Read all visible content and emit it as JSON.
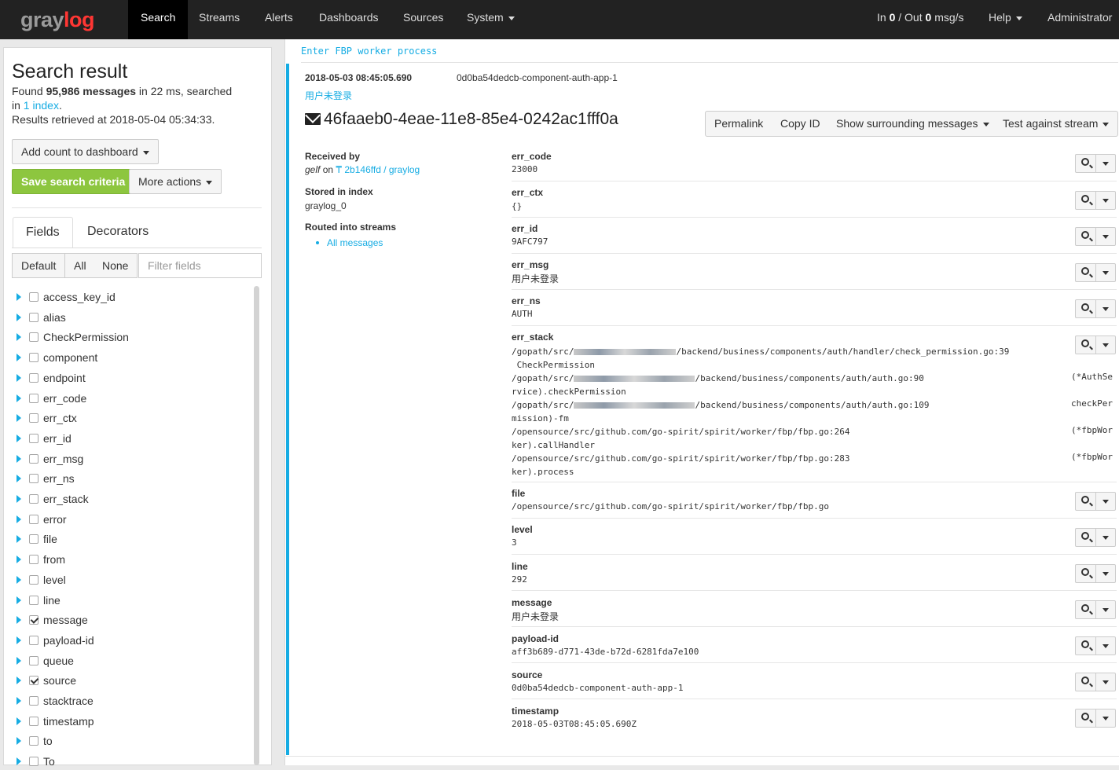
{
  "app": {
    "logo_left": "gray",
    "logo_right": "log",
    "nav": [
      "Search",
      "Streams",
      "Alerts",
      "Dashboards",
      "Sources",
      "System"
    ],
    "throughput_in_label": "In",
    "throughput_in": "0",
    "throughput_sep": "/ Out",
    "throughput_out": "0",
    "throughput_unit": "msg/s",
    "help": "Help",
    "user": "Administrator"
  },
  "sidebar": {
    "title": "Search result",
    "found_prefix": "Found",
    "found_count": "95,986 messages",
    "found_suffix": "in 22 ms, searched",
    "in_word": "in",
    "index_link": "1 index",
    "retrieved": "Results retrieved at 2018-05-04 05:34:33.",
    "add_count": "Add count to dashboard",
    "save_search": "Save search criteria",
    "more_actions": "More actions",
    "tabs": [
      "Fields",
      "Decorators"
    ],
    "filter_buttons": [
      "Default",
      "All",
      "None"
    ],
    "filter_placeholder": "Filter fields",
    "fields": [
      {
        "name": "access_key_id",
        "checked": false
      },
      {
        "name": "alias",
        "checked": false
      },
      {
        "name": "CheckPermission",
        "checked": false
      },
      {
        "name": "component",
        "checked": false
      },
      {
        "name": "endpoint",
        "checked": false
      },
      {
        "name": "err_code",
        "checked": false
      },
      {
        "name": "err_ctx",
        "checked": false
      },
      {
        "name": "err_id",
        "checked": false
      },
      {
        "name": "err_msg",
        "checked": false
      },
      {
        "name": "err_ns",
        "checked": false
      },
      {
        "name": "err_stack",
        "checked": false
      },
      {
        "name": "error",
        "checked": false
      },
      {
        "name": "file",
        "checked": false
      },
      {
        "name": "from",
        "checked": false
      },
      {
        "name": "level",
        "checked": false
      },
      {
        "name": "line",
        "checked": false
      },
      {
        "name": "message",
        "checked": true
      },
      {
        "name": "payload-id",
        "checked": false
      },
      {
        "name": "queue",
        "checked": false
      },
      {
        "name": "source",
        "checked": true
      },
      {
        "name": "stacktrace",
        "checked": false
      },
      {
        "name": "timestamp",
        "checked": false
      },
      {
        "name": "to",
        "checked": false
      },
      {
        "name": "To",
        "checked": false
      }
    ]
  },
  "message": {
    "header": "Enter FBP worker process",
    "timestamp": "2018-05-03 08:45:05.690",
    "source": "0d0ba54dedcb-component-auth-app-1",
    "summary": "用户未登录",
    "id": "46faaeb0-4eae-11e8-85e4-0242ac1fff0a",
    "toolbar": {
      "permalink": "Permalink",
      "copy_id": "Copy ID",
      "surrounding": "Show surrounding messages",
      "test_stream": "Test against stream"
    },
    "received_label": "Received by",
    "received_input": "gelf",
    "received_on": "on",
    "received_node": "2b146ffd / graylog",
    "stored_label": "Stored in index",
    "stored_value": "graylog_0",
    "routed_label": "Routed into streams",
    "routed_stream": "All messages",
    "fields": {
      "err_code": {
        "name": "err_code",
        "value": "23000"
      },
      "err_ctx": {
        "name": "err_ctx",
        "value": "{}"
      },
      "err_id": {
        "name": "err_id",
        "value": "9AFC797"
      },
      "err_msg": {
        "name": "err_msg",
        "value": "用户未登录"
      },
      "err_ns": {
        "name": "err_ns",
        "value": "AUTH"
      },
      "err_stack": {
        "name": "err_stack"
      },
      "file": {
        "name": "file",
        "value": "/opensource/src/github.com/go-spirit/spirit/worker/fbp/fbp.go"
      },
      "level": {
        "name": "level",
        "value": "3"
      },
      "line": {
        "name": "line",
        "value": "292"
      },
      "message": {
        "name": "message",
        "value": "用户未登录"
      },
      "payload_id": {
        "name": "payload-id",
        "value": "aff3b689-d771-43de-b72d-6281fda7e100"
      },
      "source": {
        "name": "source",
        "value": "0d0ba54dedcb-component-auth-app-1"
      },
      "timestamp": {
        "name": "timestamp",
        "value": "2018-05-03T08:45:05.690Z"
      }
    },
    "stack": {
      "l1a": "/gopath/src/",
      "l1b": "/backend/business/components/auth/handler/check_permission.go:39",
      "l2": " CheckPermission",
      "l3a": "/gopath/src/",
      "l3b": "/backend/business/components/auth/auth.go:90",
      "l3r": "(*AuthSe",
      "l4": "rvice).checkPermission",
      "l5a": "/gopath/src/",
      "l5b": "/backend/business/components/auth/auth.go:109",
      "l5r": "checkPer",
      "l6": "mission)-fm",
      "l7": "/opensource/src/github.com/go-spirit/spirit/worker/fbp/fbp.go:264",
      "l7r": "(*fbpWor",
      "l8": "ker).callHandler",
      "l9": "/opensource/src/github.com/go-spirit/spirit/worker/fbp/fbp.go:283",
      "l9r": "(*fbpWor",
      "l10": "ker).process"
    }
  }
}
